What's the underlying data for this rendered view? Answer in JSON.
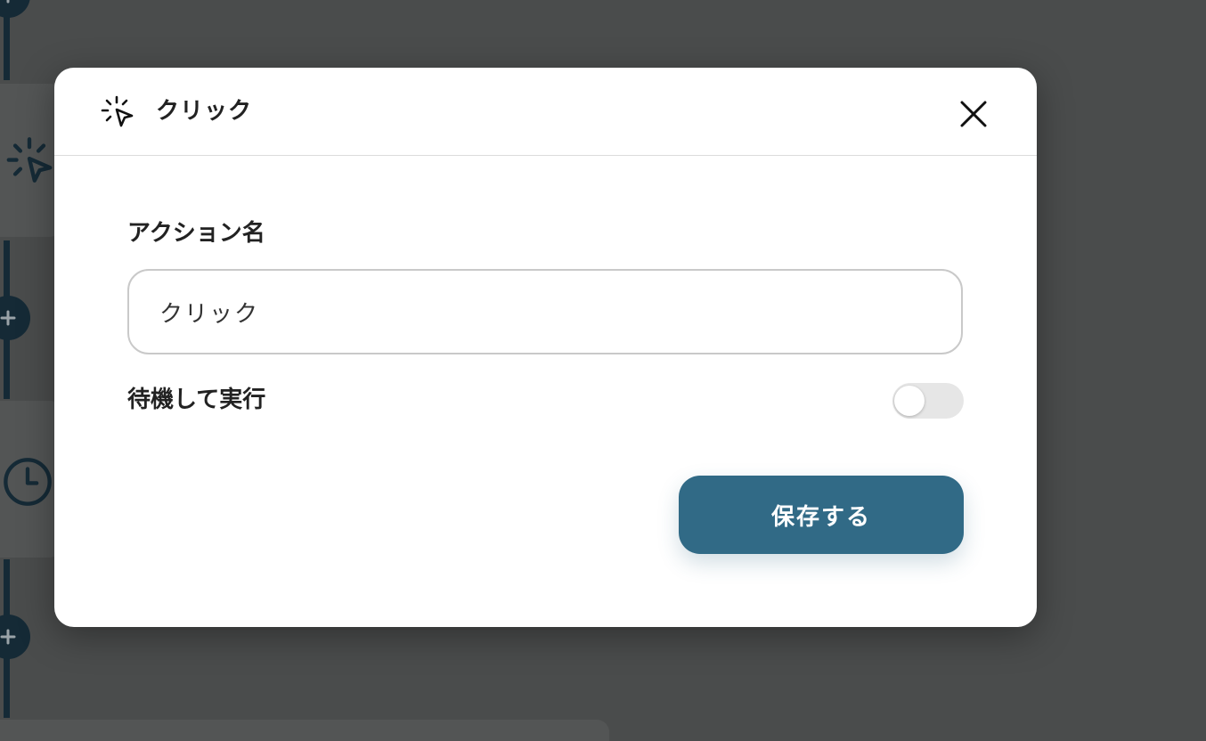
{
  "background": {
    "nodes": [
      {
        "icon": "cursor-click-icon"
      },
      {
        "icon": "clock-icon"
      }
    ]
  },
  "modal": {
    "icon": "cursor-click-icon",
    "title": "クリック",
    "close_icon": "close-icon",
    "action_name": {
      "label": "アクション名",
      "value": "クリック"
    },
    "wait": {
      "label": "待機して実行",
      "enabled": false
    },
    "save_label": "保存する"
  },
  "colors": {
    "primary": "#316a86",
    "overlay": "#4a4c4c",
    "node_dark": "#152a36"
  }
}
